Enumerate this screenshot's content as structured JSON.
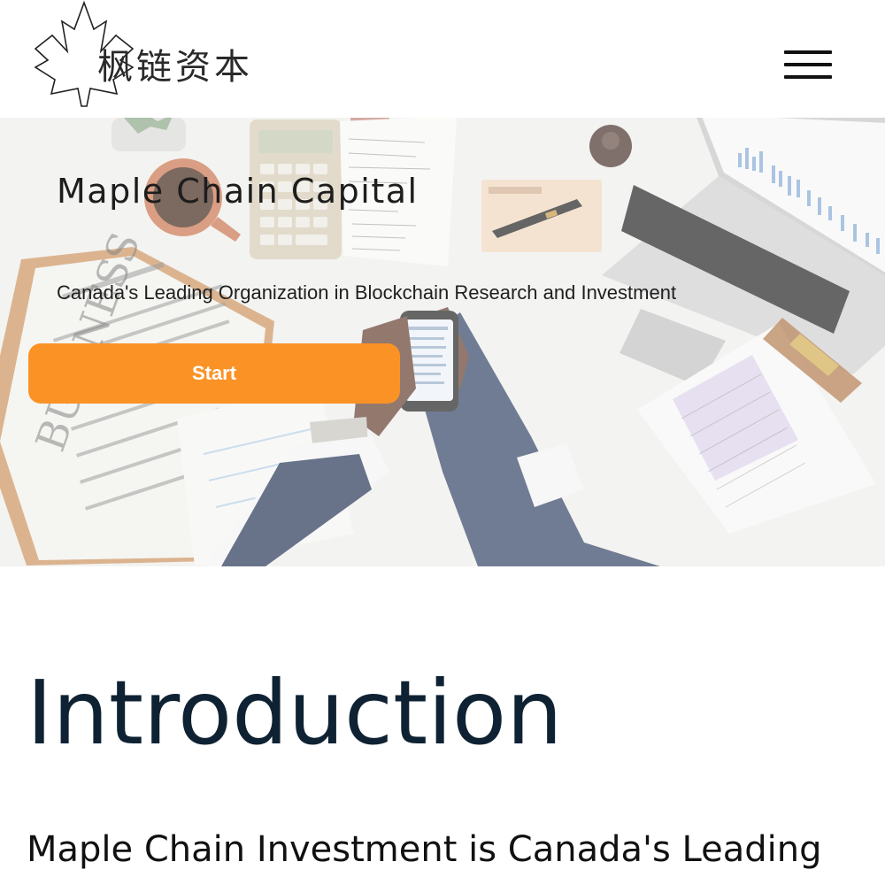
{
  "header": {
    "logo_text": "枫链资本",
    "logo_icon": "maple-leaf-icon",
    "menu_icon": "hamburger-menu-icon"
  },
  "hero": {
    "title": "Maple Chain Capital",
    "subtitle": "Canada's Leading Organization in Blockchain Research and Investment",
    "cta_label": "Start",
    "cta_color": "#fb9226"
  },
  "intro": {
    "heading": "Introduction",
    "first_line": "Maple Chain Investment is Canada's Leading"
  }
}
